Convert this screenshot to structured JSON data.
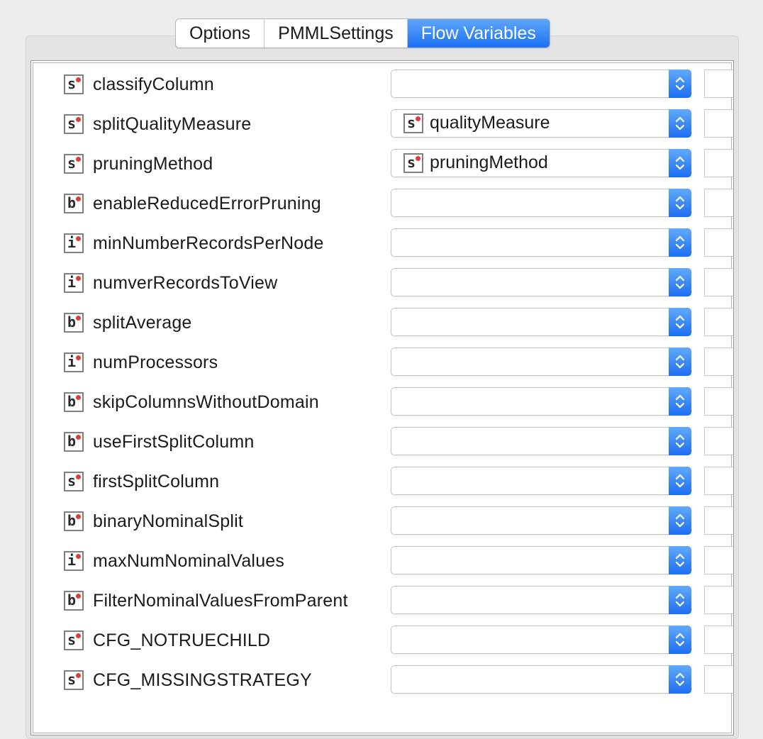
{
  "tabs": [
    {
      "label": "Options",
      "active": false
    },
    {
      "label": "PMMLSettings",
      "active": false
    },
    {
      "label": "Flow Variables",
      "active": true
    }
  ],
  "colors": {
    "accent": "#1b70f3",
    "type_dot": "#e23a3a"
  },
  "rows": [
    {
      "type": "s",
      "label": "classifyColumn",
      "value": ""
    },
    {
      "type": "s",
      "label": "splitQualityMeasure",
      "value": "qualityMeasure",
      "value_type": "s"
    },
    {
      "type": "s",
      "label": "pruningMethod",
      "value": "pruningMethod",
      "value_type": "s"
    },
    {
      "type": "b",
      "label": "enableReducedErrorPruning",
      "value": ""
    },
    {
      "type": "i",
      "label": "minNumberRecordsPerNode",
      "value": ""
    },
    {
      "type": "i",
      "label": "numverRecordsToView",
      "value": ""
    },
    {
      "type": "b",
      "label": "splitAverage",
      "value": ""
    },
    {
      "type": "i",
      "label": "numProcessors",
      "value": ""
    },
    {
      "type": "b",
      "label": "skipColumnsWithoutDomain",
      "value": ""
    },
    {
      "type": "b",
      "label": "useFirstSplitColumn",
      "value": ""
    },
    {
      "type": "s",
      "label": "firstSplitColumn",
      "value": ""
    },
    {
      "type": "b",
      "label": "binaryNominalSplit",
      "value": ""
    },
    {
      "type": "i",
      "label": "maxNumNominalValues",
      "value": ""
    },
    {
      "type": "b",
      "label": "FilterNominalValuesFromParent",
      "value": ""
    },
    {
      "type": "s",
      "label": "CFG_NOTRUECHILD",
      "value": ""
    },
    {
      "type": "s",
      "label": "CFG_MISSINGSTRATEGY",
      "value": ""
    }
  ]
}
